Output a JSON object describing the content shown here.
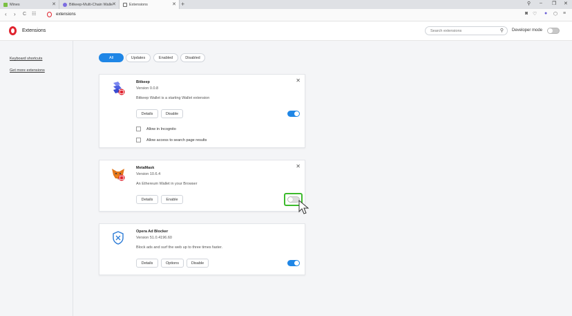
{
  "tabs": [
    {
      "label": "Mines",
      "close": "✕"
    },
    {
      "label": "Bitkeep-Multi-Chain Walle",
      "close": "✕"
    },
    {
      "label": "Extensions",
      "close": "✕"
    }
  ],
  "new_tab": "+",
  "address": {
    "url": "extensions"
  },
  "header": {
    "title": "Extensions",
    "search_placeholder": "Search extensions",
    "developer_mode_label": "Developer mode",
    "developer_mode_on": false
  },
  "sidebar": {
    "links": [
      {
        "label": "Keyboard shortcuts"
      },
      {
        "label": "Get more extensions"
      }
    ]
  },
  "filters": [
    {
      "label": "All",
      "active": true
    },
    {
      "label": "Updates",
      "active": false
    },
    {
      "label": "Enabled",
      "active": false
    },
    {
      "label": "Disabled",
      "active": false
    }
  ],
  "extensions": [
    {
      "name": "Bitkeep",
      "version": "Version 0.0.8",
      "description": "Bitkeep Wallet is a starting Wallet extension",
      "buttons": [
        "Details",
        "Disable"
      ],
      "enabled": true,
      "options": [
        "Allow in Incognito",
        "Allow access to search page results"
      ]
    },
    {
      "name": "MetaMask",
      "version": "Version 10.6.4",
      "description": "An Ethereum Wallet in your Browser",
      "buttons": [
        "Details",
        "Enable"
      ],
      "enabled": false
    },
    {
      "name": "Opera Ad Blocker",
      "version": "Version 51.0.4196.60",
      "description": "Block ads and surf the web up to three times faster.",
      "buttons": [
        "Details",
        "Options",
        "Disable"
      ],
      "enabled": true
    }
  ],
  "colors": {
    "accent": "#1f86e6",
    "opera_red": "#e0242f",
    "highlight": "#3cba2c"
  },
  "icons": {
    "back": "‹",
    "forward": "›",
    "reload": "C",
    "close_card": "✕",
    "search": "⚲"
  }
}
